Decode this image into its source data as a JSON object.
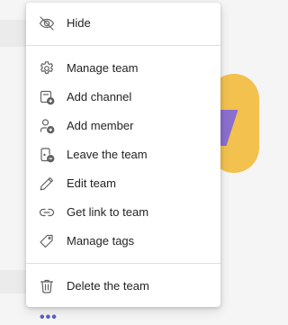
{
  "menu": {
    "items": [
      {
        "label": "Hide",
        "icon": "eye-off-icon"
      },
      {
        "label": "Manage team",
        "icon": "gear-icon"
      },
      {
        "label": "Add channel",
        "icon": "add-channel-icon"
      },
      {
        "label": "Add member",
        "icon": "add-member-icon"
      },
      {
        "label": "Leave the team",
        "icon": "leave-door-icon"
      },
      {
        "label": "Edit team",
        "icon": "pencil-icon"
      },
      {
        "label": "Get link to team",
        "icon": "link-icon"
      },
      {
        "label": "Manage tags",
        "icon": "tag-icon"
      },
      {
        "label": "Delete the team",
        "icon": "trash-icon"
      }
    ]
  },
  "background": {
    "more_options": "•••"
  },
  "colors": {
    "text": "#252423",
    "icon": "#616161",
    "accent": "#5b5fc7"
  }
}
